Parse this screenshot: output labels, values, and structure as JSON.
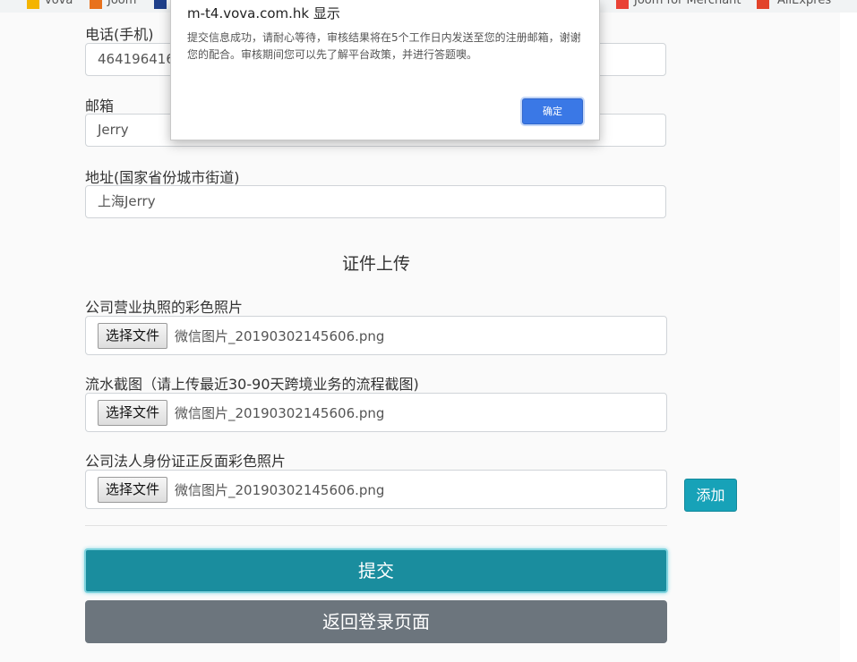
{
  "bookmarks": [
    "vova",
    "Joom",
    "Joom for Merchant",
    "AliExpres"
  ],
  "dialog": {
    "title": "m-t4.vova.com.hk 显示",
    "message": "提交信息成功，请耐心等待，审核结果将在5个工作日内发送至您的注册邮箱，谢谢您的配合。审核期间您可以先了解平台政策，并进行答题噢。",
    "ok_label": "确定"
  },
  "form": {
    "phone": {
      "label": "电话(手机)",
      "value": "4641964164"
    },
    "email": {
      "label": "邮箱",
      "value": "Jerry"
    },
    "address": {
      "label": "地址(国家省份城市街道)",
      "value": "上海Jerry"
    },
    "section_title": "证件上传",
    "files": [
      {
        "label": "公司营业执照的彩色照片",
        "button": "选择文件",
        "filename": "微信图片_20190302145606.png"
      },
      {
        "label": "流水截图（请上传最近30-90天跨境业务的流程截图)",
        "button": "选择文件",
        "filename": "微信图片_20190302145606.png"
      },
      {
        "label": "公司法人身份证正反面彩色照片",
        "button": "选择文件",
        "filename": "微信图片_20190302145606.png"
      }
    ],
    "add_label": "添加",
    "submit_label": "提交",
    "back_label": "返回登录页面"
  },
  "colors": {
    "accent": "#17a2b8",
    "submit": "#1a8d9e",
    "secondary": "#6c757d",
    "dialog_button": "#3a78e6"
  }
}
